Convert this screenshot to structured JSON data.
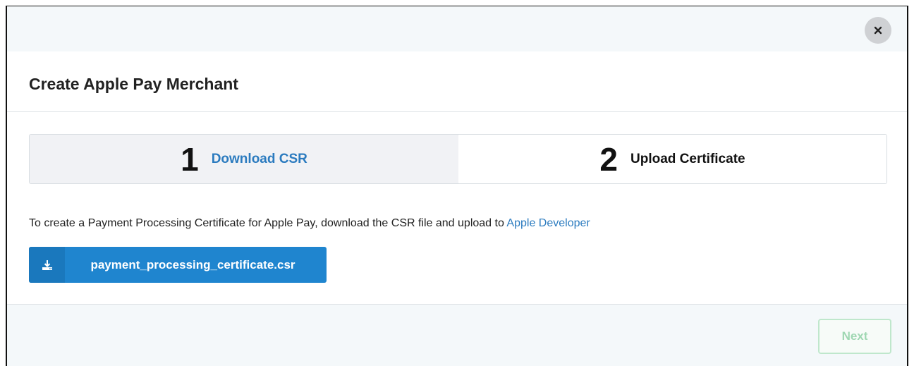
{
  "modal": {
    "title": "Create Apple Pay Merchant",
    "close_icon": "close-icon"
  },
  "steps": [
    {
      "number": "1",
      "label": "Download CSR",
      "active": true
    },
    {
      "number": "2",
      "label": "Upload Certificate",
      "active": false
    }
  ],
  "description": {
    "text": "To create a Payment Processing Certificate for Apple Pay, download the CSR file and upload to ",
    "link": "Apple Developer"
  },
  "download": {
    "icon": "download-icon",
    "label": "payment_processing_certificate.csr"
  },
  "footer": {
    "next_label": "Next"
  },
  "colors": {
    "accent": "#2b7bbf",
    "button": "#1f85cf",
    "next_border": "#bfe7cc",
    "next_text": "#9fd7b2"
  }
}
